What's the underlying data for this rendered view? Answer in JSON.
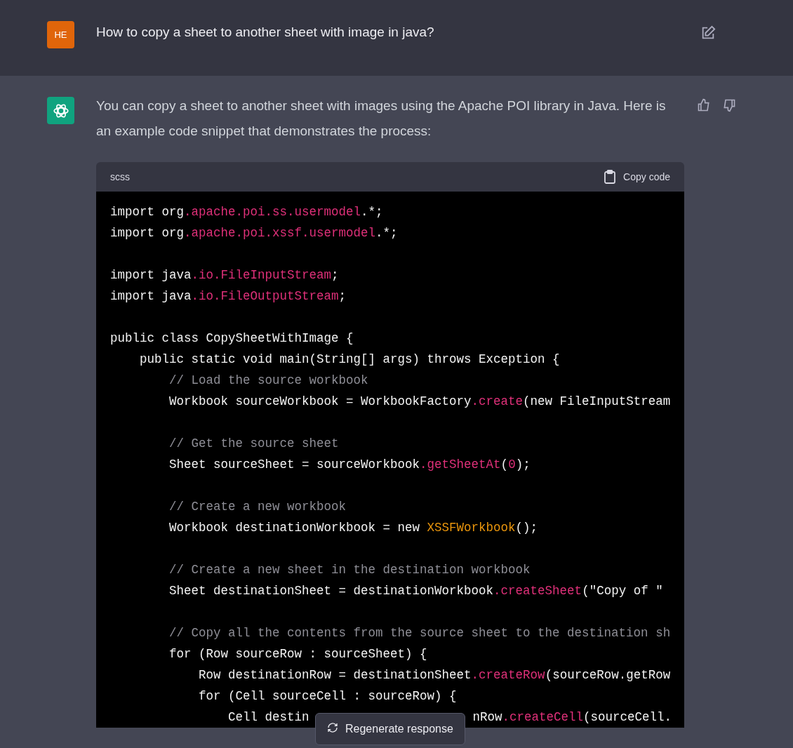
{
  "question": {
    "avatar": "HE",
    "text": "How to copy a sheet to another sheet with image in java?"
  },
  "answer": {
    "paragraph": "You can copy a sheet to another sheet with images using the Apache POI library in Java. Here is an example code snippet that demonstrates the process:",
    "code_block": {
      "language": "scss",
      "copy_label": "Copy code",
      "lines": [
        {
          "segments": [
            {
              "text": "import org",
              "kind": "plain"
            },
            {
              "text": ".apache.poi.ss.usermodel",
              "kind": "member"
            },
            {
              "text": ".*;",
              "kind": "plain"
            }
          ]
        },
        {
          "segments": [
            {
              "text": "import org",
              "kind": "plain"
            },
            {
              "text": ".apache.poi.xssf.usermodel",
              "kind": "member"
            },
            {
              "text": ".*;",
              "kind": "plain"
            }
          ]
        },
        {
          "kind": "blank"
        },
        {
          "segments": [
            {
              "text": "import java",
              "kind": "plain"
            },
            {
              "text": ".io.FileInputStream",
              "kind": "member"
            },
            {
              "text": ";",
              "kind": "plain"
            }
          ]
        },
        {
          "segments": [
            {
              "text": "import java",
              "kind": "plain"
            },
            {
              "text": ".io.FileOutputStream",
              "kind": "member"
            },
            {
              "text": ";",
              "kind": "plain"
            }
          ]
        },
        {
          "kind": "blank"
        },
        {
          "segments": [
            {
              "text": "public class CopySheetWithImage {",
              "kind": "plain"
            }
          ]
        },
        {
          "segments": [
            {
              "text": "    public static void main(String[] args) throws Exception {",
              "kind": "plain"
            }
          ]
        },
        {
          "segments": [
            {
              "text": "        // Load the source workbook",
              "kind": "comment"
            }
          ]
        },
        {
          "segments": [
            {
              "text": "        Workbook sourceWorkbook = WorkbookFactory",
              "kind": "plain"
            },
            {
              "text": ".create",
              "kind": "member"
            },
            {
              "text": "(new FileInputStream",
              "kind": "plain"
            }
          ]
        },
        {
          "kind": "blank"
        },
        {
          "segments": [
            {
              "text": "        // Get the source sheet",
              "kind": "comment"
            }
          ]
        },
        {
          "segments": [
            {
              "text": "        Sheet sourceSheet = sourceWorkbook",
              "kind": "plain"
            },
            {
              "text": ".getSheetAt",
              "kind": "member"
            },
            {
              "text": "(",
              "kind": "plain"
            },
            {
              "text": "0",
              "kind": "member"
            },
            {
              "text": ");",
              "kind": "plain"
            }
          ]
        },
        {
          "kind": "blank"
        },
        {
          "segments": [
            {
              "text": "        // Create a new workbook",
              "kind": "comment"
            }
          ]
        },
        {
          "segments": [
            {
              "text": "        Workbook destinationWorkbook = new ",
              "kind": "plain"
            },
            {
              "text": "XSSFWorkbook",
              "kind": "class"
            },
            {
              "text": "();",
              "kind": "plain"
            }
          ]
        },
        {
          "kind": "blank"
        },
        {
          "segments": [
            {
              "text": "        // Create a new sheet in the destination workbook",
              "kind": "comment"
            }
          ]
        },
        {
          "segments": [
            {
              "text": "        Sheet destinationSheet = destinationWorkbook",
              "kind": "plain"
            },
            {
              "text": ".createSheet",
              "kind": "member"
            },
            {
              "text": "(\"Copy of \"",
              "kind": "plain"
            }
          ]
        },
        {
          "kind": "blank"
        },
        {
          "segments": [
            {
              "text": "        // Copy all the contents from the source sheet to the destination sh",
              "kind": "comment"
            }
          ]
        },
        {
          "segments": [
            {
              "text": "        for (Row sourceRow : sourceSheet) {",
              "kind": "plain"
            }
          ]
        },
        {
          "segments": [
            {
              "text": "            Row destinationRow = destinationSheet",
              "kind": "plain"
            },
            {
              "text": ".createRow",
              "kind": "member"
            },
            {
              "text": "(sourceRow.getRow",
              "kind": "plain"
            }
          ]
        },
        {
          "segments": [
            {
              "text": "            for (Cell sourceCell : sourceRow) {",
              "kind": "plain"
            }
          ]
        },
        {
          "segments": [
            {
              "text": "                Cell destin",
              "kind": "plain"
            }
          ],
          "after_button": [
            {
              "text": "nRow",
              "kind": "plain"
            },
            {
              "text": ".createCell",
              "kind": "member"
            },
            {
              "text": "(sourceCell.",
              "kind": "plain"
            }
          ]
        }
      ]
    }
  },
  "regenerate_button": "Regenerate response"
}
